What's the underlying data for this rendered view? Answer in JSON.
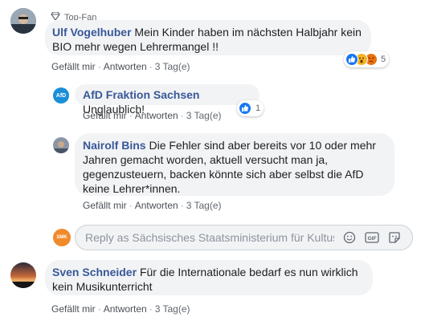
{
  "comments": [
    {
      "badge": "Top-Fan",
      "author": "Ulf Vogelhuber",
      "text": "Mein Kinder haben im nächsten Halbjahr kein BIO mehr wegen Lehrermangel !!",
      "like": "Gefällt mir",
      "reply": "Antworten",
      "time": "3 Tag(e)",
      "reaction_count": "5"
    },
    {
      "author": "Sven Schneider",
      "text": "Für die Internationale bedarf es nun wirklich kein Musikunterricht",
      "like": "Gefällt mir",
      "reply": "Antworten",
      "time": "3 Tag(e)"
    }
  ],
  "replies": [
    {
      "author": "AfD Fraktion Sachsen",
      "text": "Unglaublich!",
      "like": "Gefällt mir",
      "reply": "Antworten",
      "time": "3 Tag(e)",
      "reaction_count": "1",
      "avatar_text": "AfD"
    },
    {
      "author": "Nairolf Bins",
      "text": "Die Fehler sind aber bereits vor 10 oder mehr Jahren gemacht worden, aktuell versucht man ja, gegenzusteuern, backen könnte sich aber selbst die AfD keine Lehrer*innen.",
      "like": "Gefällt mir",
      "reply": "Antworten",
      "time": "3 Tag(e)"
    }
  ],
  "reply_input": {
    "placeholder": "Reply as Sächsisches Staatsministerium für Kultus",
    "avatar_text": "SMK"
  },
  "colors": {
    "link": "#385898",
    "bubble": "#f2f3f5",
    "like_blue": "#1877f2",
    "love_red": "#f33e58",
    "wow_yellow": "#f7b125",
    "angry_orange": "#e9710f"
  }
}
